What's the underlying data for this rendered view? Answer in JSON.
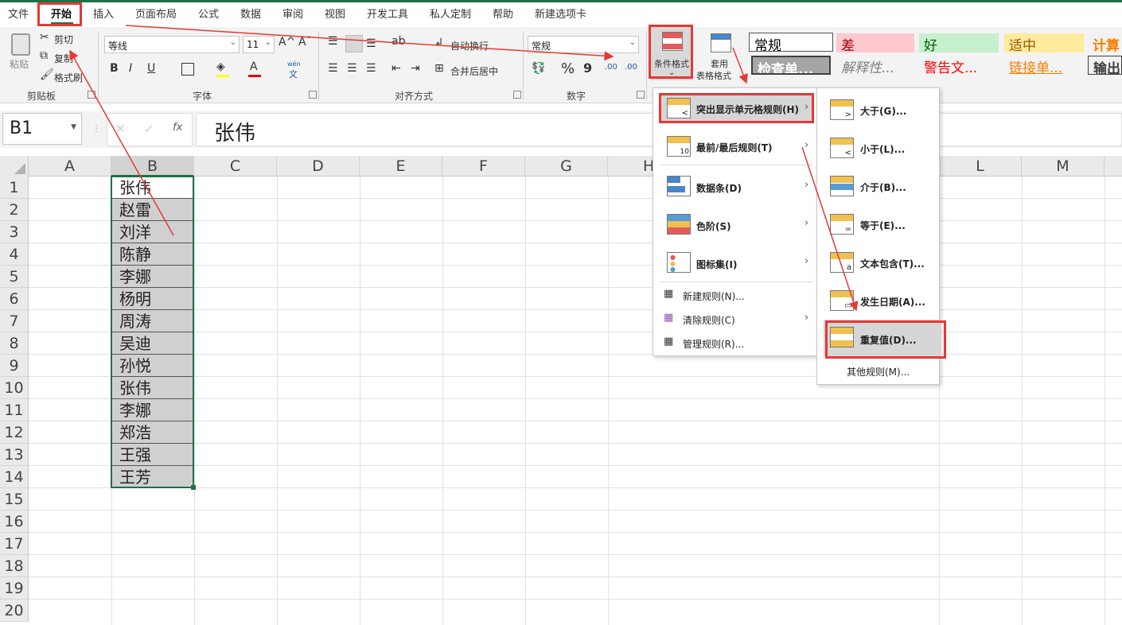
{
  "menu_tabs": [
    "文件",
    "开始",
    "插入",
    "页面布局",
    "公式",
    "数据",
    "审阅",
    "视图",
    "开发工具",
    "私人定制",
    "帮助",
    "新建选项卡"
  ],
  "clipboard": {
    "paste": "粘贴",
    "cut": "剪切",
    "copy": "复制",
    "format_painter": "格式刷",
    "group": "剪贴板"
  },
  "font": {
    "name": "等线",
    "size": "11",
    "grow": "A^",
    "shrink": "Aˇ",
    "bold": "B",
    "italic": "I",
    "underline": "U",
    "wen": "wén",
    "wen_char": "文",
    "group": "字体"
  },
  "alignment": {
    "wrap": "自动换行",
    "merge": "合并后居中",
    "group": "对齐方式"
  },
  "number": {
    "format": "常规",
    "percent": "%",
    "comma": "9",
    "inc": ".00",
    "dec": ".00",
    "group": "数字"
  },
  "styles_btns": {
    "conditional": "条件格式",
    "table_fmt_1": "套用",
    "table_fmt_2": "表格格式"
  },
  "styles": [
    {
      "label": "常规",
      "color": "#000000",
      "bg": "#ffffff"
    },
    {
      "label": "差",
      "color": "#9c0006",
      "bg": "#ffc7ce"
    },
    {
      "label": "好",
      "color": "#006100",
      "bg": "#c6efce"
    },
    {
      "label": "适中",
      "color": "#9c5700",
      "bg": "#ffeb9c"
    },
    {
      "label": "计算",
      "color": "#fa7d00",
      "bg": "#f2f2f2"
    },
    {
      "label": "检查单...",
      "color": "#ffffff",
      "bg": "#a5a5a5"
    },
    {
      "label": "解释性...",
      "color": "#7f7f7f",
      "bg": "#ffffff"
    },
    {
      "label": "警告文...",
      "color": "#ff0000",
      "bg": "#ffffff"
    },
    {
      "label": "链接单...",
      "color": "#fa7d00",
      "bg": "#ffffff"
    },
    {
      "label": "输出",
      "color": "#3f3f3f",
      "bg": "#f2f2f2"
    }
  ],
  "name_box": "B1",
  "formula_value": "张伟",
  "fx": "fx",
  "columns": [
    "A",
    "B",
    "C",
    "D",
    "E",
    "F",
    "G",
    "H",
    "L",
    "M"
  ],
  "rows": [
    "1",
    "2",
    "3",
    "4",
    "5",
    "6",
    "7",
    "8",
    "9",
    "10",
    "11",
    "12",
    "13",
    "14",
    "15",
    "16",
    "17",
    "18",
    "19",
    "20"
  ],
  "column_b": [
    "张伟",
    "赵雷",
    "刘洋",
    "陈静",
    "李娜",
    "杨明",
    "周涛",
    "吴迪",
    "孙悦",
    "张伟",
    "李娜",
    "郑浩",
    "王强",
    "王芳"
  ],
  "cf_menu": {
    "highlight": "突出显示单元格规则(H)",
    "topbottom": "最前/最后规则(T)",
    "databar": "数据条(D)",
    "colorscale": "色阶(S)",
    "iconset": "图标集(I)",
    "new_rule": "新建规则(N)...",
    "clear_rules": "清除规则(C)",
    "manage_rules": "管理规则(R)..."
  },
  "sub_menu": {
    "greater": "大于(G)...",
    "less": "小于(L)...",
    "between": "介于(B)...",
    "equal": "等于(E)...",
    "text_contains": "文本包含(T)...",
    "date": "发生日期(A)...",
    "duplicate": "重复值(D)...",
    "more": "其他规则(M)..."
  },
  "colors": {
    "accent": "#1e7145",
    "annotation": "#e53935"
  }
}
